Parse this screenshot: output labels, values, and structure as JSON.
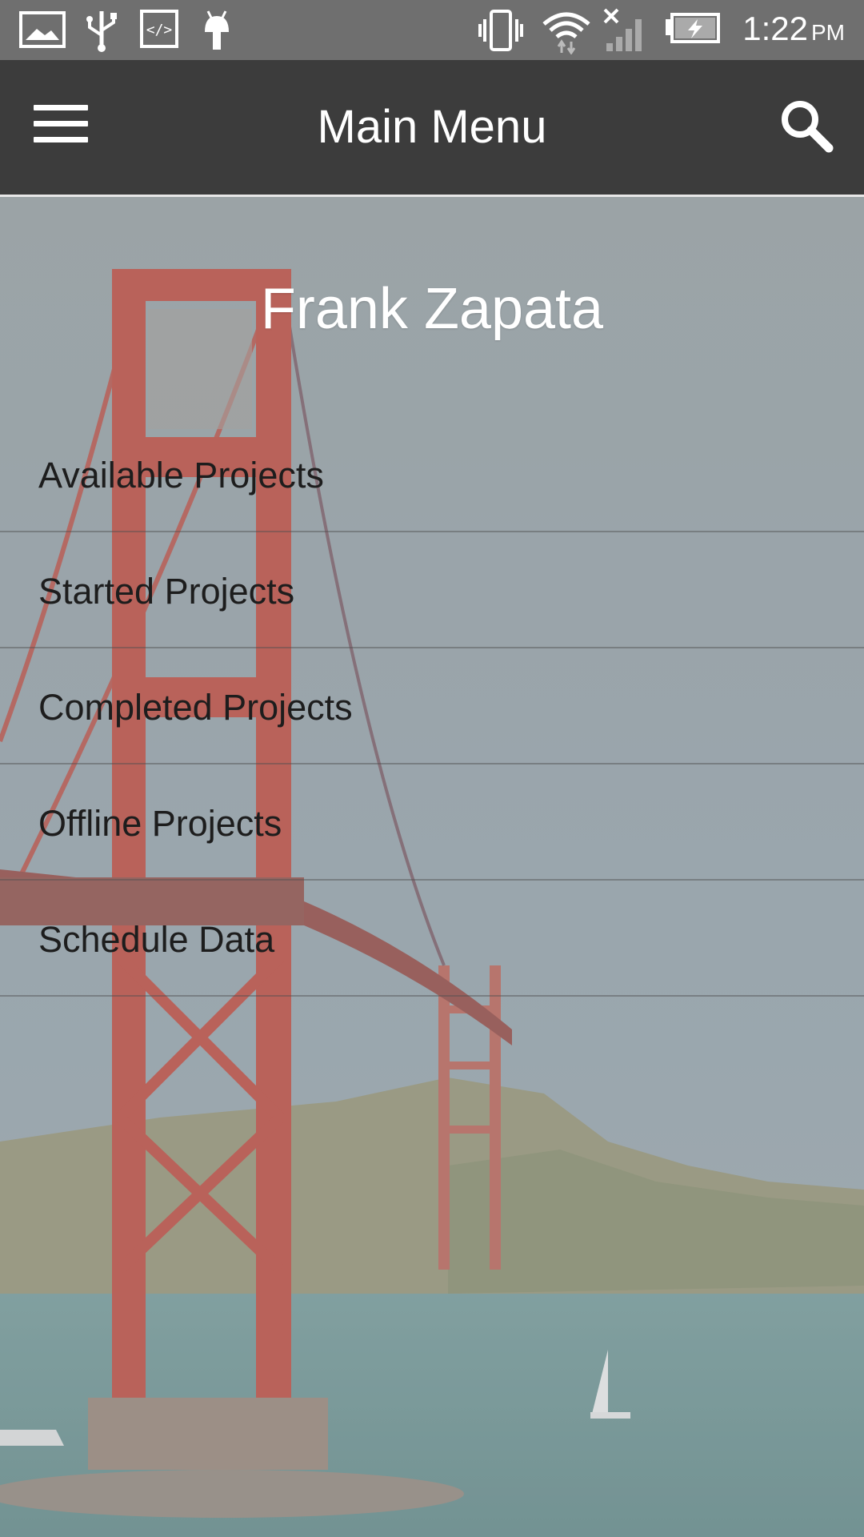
{
  "status_bar": {
    "time": "1:22",
    "ampm": "PM",
    "icons": [
      "image-icon",
      "usb-icon",
      "code-icon",
      "android-icon",
      "vibrate-icon",
      "wifi-icon",
      "signal-icon",
      "battery-charging-icon"
    ]
  },
  "app_bar": {
    "title": "Main Menu",
    "left_icon": "hamburger-menu-icon",
    "right_icon": "search-icon"
  },
  "drawer": {
    "user_name": "Frank Zapata",
    "items": [
      {
        "label": "Available Projects"
      },
      {
        "label": "Started Projects"
      },
      {
        "label": "Completed Projects"
      },
      {
        "label": "Offline Projects"
      },
      {
        "label": "Schedule Data"
      }
    ]
  },
  "colors": {
    "app_bar": "#3c3c3c",
    "status_bar": "#6f6f6f",
    "bridge": "#b83c30",
    "water": "#5f8886"
  }
}
